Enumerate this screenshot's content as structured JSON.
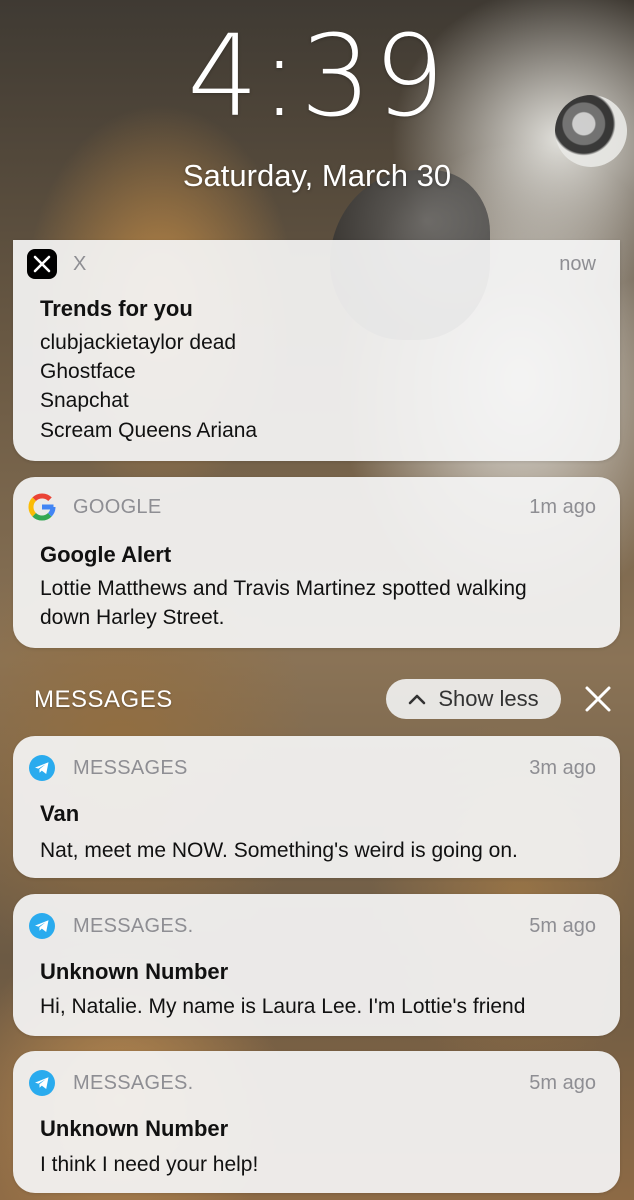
{
  "lock_screen": {
    "time": "4:39",
    "date": "Saturday, March 30"
  },
  "notifications_top": [
    {
      "app": "X",
      "time": "now",
      "title": "Trends for you",
      "lines": [
        "clubjackietaylor dead",
        "Ghostface",
        "Snapchat",
        "Scream Queens Ariana"
      ]
    },
    {
      "app": "GOOGLE",
      "time": "1m ago",
      "title": "Google Alert",
      "lines": [
        "Lottie Matthews and Travis Martinez spotted walking",
        "down Harley Street."
      ]
    }
  ],
  "messages_group": {
    "header": "MESSAGES",
    "show_less_label": "Show less",
    "items": [
      {
        "app": "MESSAGES",
        "time": "3m ago",
        "title": "Van",
        "lines": [
          "Nat, meet me NOW. Something's weird is going on."
        ]
      },
      {
        "app": "MESSAGES.",
        "time": "5m ago",
        "title": "Unknown Number",
        "lines": [
          "Hi, Natalie. My name is Laura Lee. I'm Lottie's friend"
        ]
      },
      {
        "app": "MESSAGES.",
        "time": "5m ago",
        "title": "Unknown Number",
        "lines": [
          "I think I need your help!"
        ]
      }
    ]
  },
  "icons": {
    "x_app": "x-logo-icon",
    "google_app": "google-g-icon",
    "messages_app": "telegram-icon",
    "show_less": "chevron-up-icon",
    "close": "close-icon"
  },
  "colors": {
    "telegram_blue": "#2AABEE",
    "google_blue": "#4285F4",
    "google_red": "#EA4335",
    "google_yellow": "#FBBC05",
    "google_green": "#34A853"
  }
}
